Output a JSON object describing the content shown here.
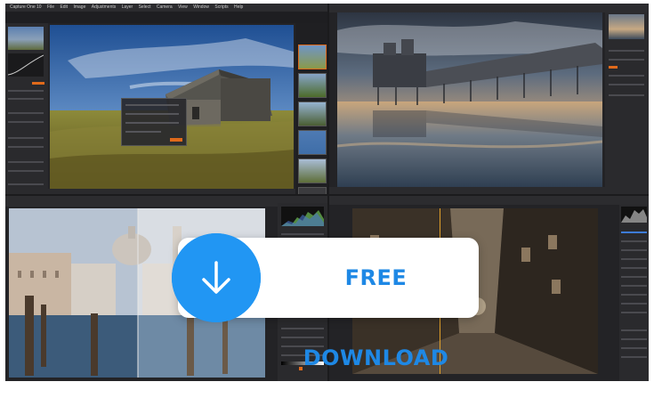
{
  "app": {
    "menu": [
      "Capture One 10",
      "File",
      "Edit",
      "Image",
      "Adjustments",
      "Layer",
      "Select",
      "Camera",
      "View",
      "Window",
      "Scripts",
      "Help"
    ]
  },
  "cta": {
    "label": "FREE DOWNLOAD",
    "icon": "download-arrow-icon"
  },
  "colors": {
    "accent_blue": "#2196f3",
    "cta_text": "#1e88e5",
    "ui_orange": "#e06a1b",
    "ui_dark": "#232326"
  },
  "panes": [
    {
      "name": "barn-editor",
      "subject": "stone barn in a grassy field"
    },
    {
      "name": "pier-editor",
      "subject": "seaside pier reflected on wet sand"
    },
    {
      "name": "venice-editor",
      "subject": "Venice canal before/after comparison"
    },
    {
      "name": "alley-editor",
      "subject": "night street in sepia tone"
    }
  ]
}
